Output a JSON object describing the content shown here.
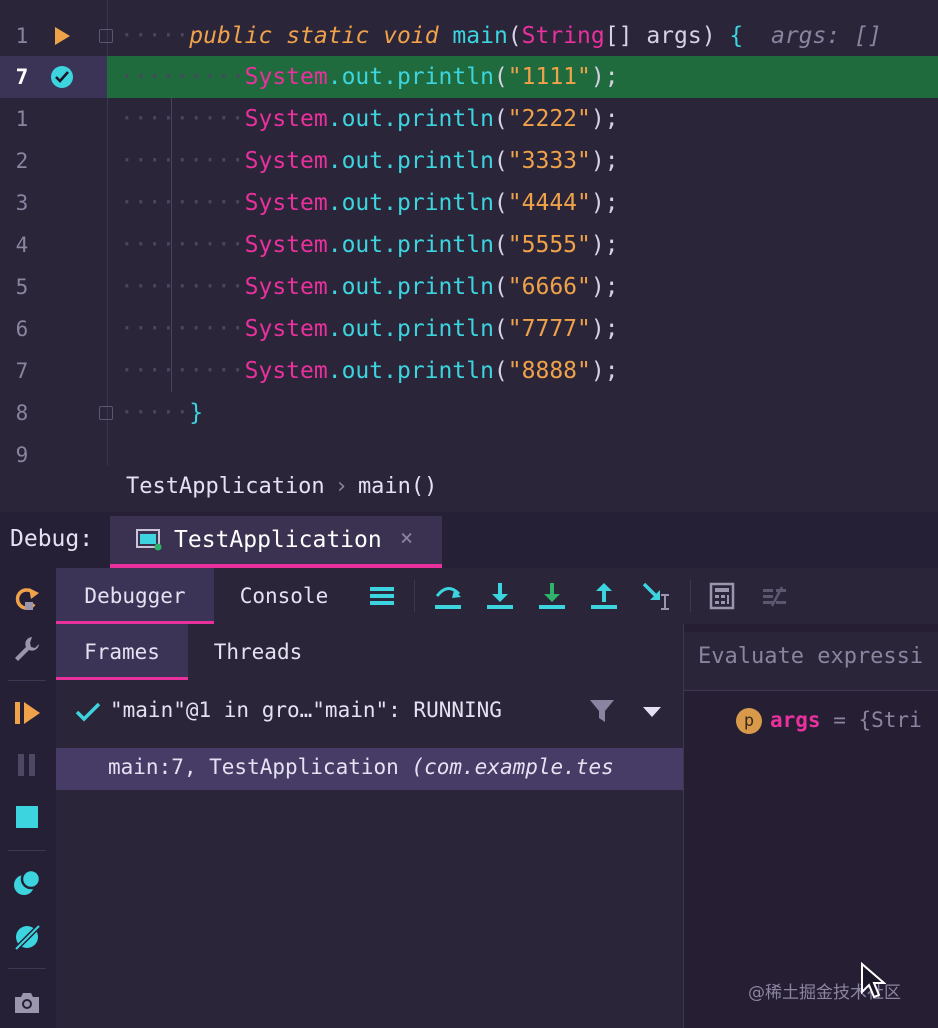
{
  "editor": {
    "lines": [
      {
        "num": "1",
        "kind": "signature",
        "mod1": "public",
        "mod2": "static",
        "mod3": "void",
        "method": "main",
        "paren_open": "(",
        "type": "String",
        "arr": "[]",
        "arg": "args",
        "paren_close": ")",
        "brace": "{",
        "hint": "args: []"
      },
      {
        "num": "7",
        "kind": "println",
        "cls": "System",
        "dot1": ".",
        "field": "out",
        "dot2": ".",
        "method": "println",
        "arg": "\"1111\"",
        "end": ";"
      },
      {
        "num": "1",
        "kind": "println",
        "cls": "System",
        "dot1": ".",
        "field": "out",
        "dot2": ".",
        "method": "println",
        "arg": "\"2222\"",
        "end": ";"
      },
      {
        "num": "2",
        "kind": "println",
        "cls": "System",
        "dot1": ".",
        "field": "out",
        "dot2": ".",
        "method": "println",
        "arg": "\"3333\"",
        "end": ";"
      },
      {
        "num": "3",
        "kind": "println",
        "cls": "System",
        "dot1": ".",
        "field": "out",
        "dot2": ".",
        "method": "println",
        "arg": "\"4444\"",
        "end": ";"
      },
      {
        "num": "4",
        "kind": "println",
        "cls": "System",
        "dot1": ".",
        "field": "out",
        "dot2": ".",
        "method": "println",
        "arg": "\"5555\"",
        "end": ";"
      },
      {
        "num": "5",
        "kind": "println",
        "cls": "System",
        "dot1": ".",
        "field": "out",
        "dot2": ".",
        "method": "println",
        "arg": "\"6666\"",
        "end": ";"
      },
      {
        "num": "6",
        "kind": "println",
        "cls": "System",
        "dot1": ".",
        "field": "out",
        "dot2": ".",
        "method": "println",
        "arg": "\"7777\"",
        "end": ";"
      },
      {
        "num": "7",
        "kind": "println",
        "cls": "System",
        "dot1": ".",
        "field": "out",
        "dot2": ".",
        "method": "println",
        "arg": "\"8888\"",
        "end": ";"
      },
      {
        "num": "8",
        "kind": "close",
        "brace": "}"
      },
      {
        "num": "9",
        "kind": "empty"
      }
    ],
    "current_line_index": 1,
    "breadcrumb": {
      "file": "TestApplication",
      "method": "main()"
    }
  },
  "debug": {
    "label": "Debug:",
    "tab_title": "TestApplication",
    "tab_close": "×",
    "toolbar_tabs": {
      "debugger": "Debugger",
      "console": "Console"
    },
    "frames_tabs": {
      "frames": "Frames",
      "threads": "Threads"
    },
    "thread_status": "\"main\"@1 in gro…\"main\": RUNNING",
    "frame": {
      "location": "main:7, TestApplication ",
      "package": "(com.example.tes"
    },
    "evaluate_placeholder": "Evaluate expressi",
    "variable": {
      "badge": "p",
      "name": "args",
      "value": " = {Stri"
    }
  },
  "watermark": "@稀土掘金技术社区",
  "colors": {
    "accent": "#e8319c",
    "execution_line": "#1f6b3e",
    "keyword": "#f0a24a",
    "method": "#3cd5df",
    "class": "#e8319c"
  },
  "icons": {
    "gutter_run": "run-arrow-icon",
    "gutter_breakpoint": "breakpoint-check-icon",
    "rerun": "rerun-icon",
    "settings": "wrench-icon",
    "resume": "resume-icon",
    "pause": "pause-icon",
    "stop": "stop-icon",
    "view_breakpoints": "view-breakpoints-icon",
    "mute_breakpoints": "mute-breakpoints-icon",
    "snapshot": "camera-icon",
    "layout": "layout-menu-icon",
    "step_over": "step-over-icon",
    "step_into": "step-into-icon",
    "force_step_into": "force-step-into-icon",
    "step_out": "step-out-icon",
    "run_to_cursor": "run-to-cursor-icon",
    "evaluate": "calculator-icon",
    "trace": "trace-icon",
    "thread_ok": "check-icon",
    "filter": "filter-icon",
    "dropdown": "chevron-down-icon"
  }
}
